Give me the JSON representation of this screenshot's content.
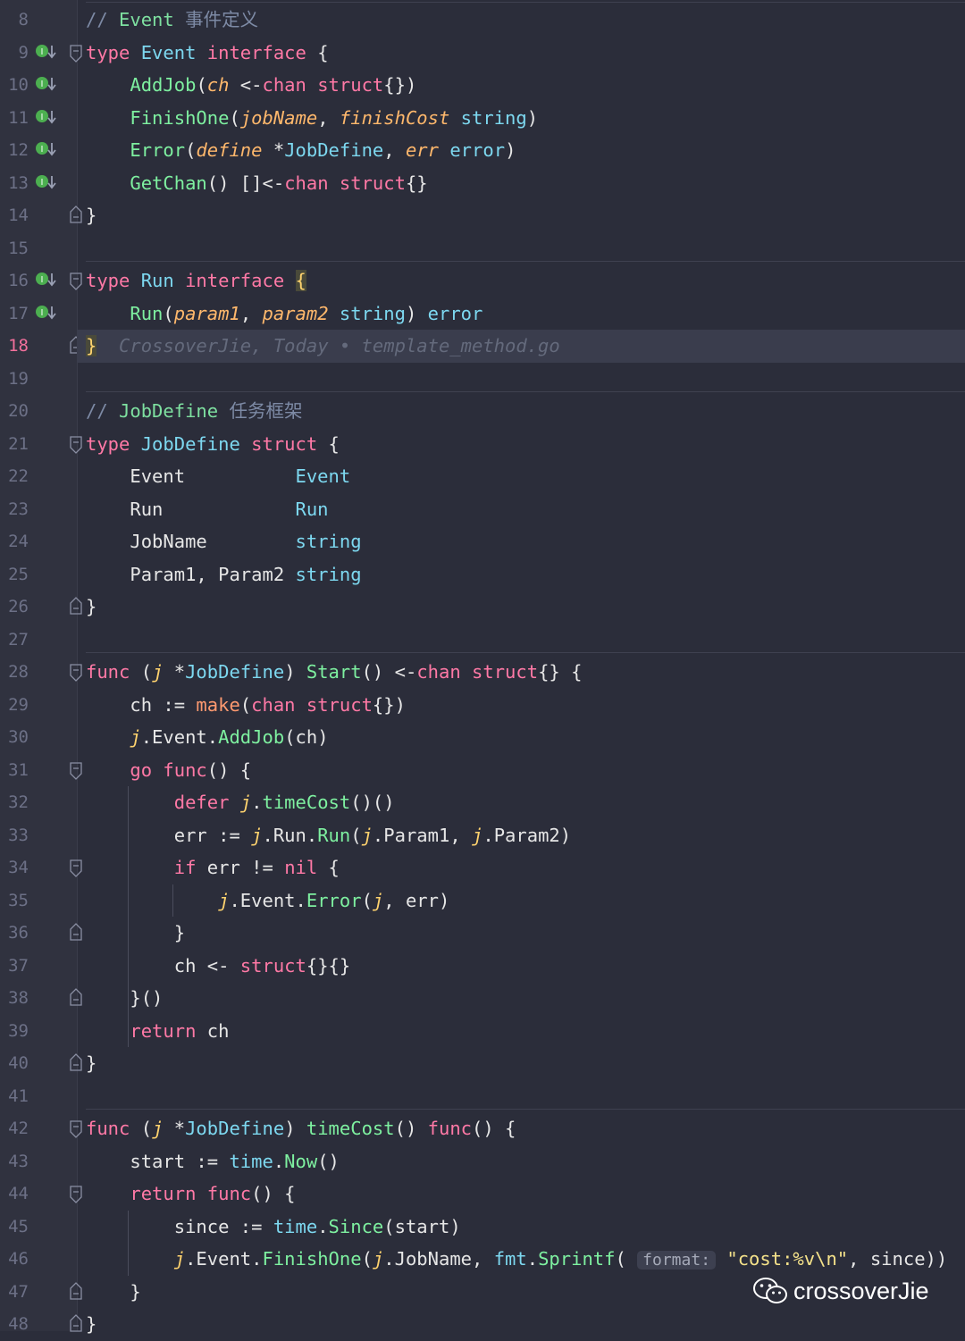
{
  "editor": {
    "file_blame": "CrossoverJie, Today • template_method.go",
    "current_line": 18,
    "watermark": "crossoverJie",
    "param_hint": "format:",
    "line_numbers": [
      "8",
      "9",
      "10",
      "11",
      "12",
      "13",
      "14",
      "15",
      "16",
      "17",
      "18",
      "19",
      "20",
      "21",
      "22",
      "23",
      "24",
      "25",
      "26",
      "27",
      "28",
      "29",
      "30",
      "31",
      "32",
      "33",
      "34",
      "35",
      "36",
      "37",
      "38",
      "39",
      "40",
      "41",
      "42",
      "43",
      "44",
      "45",
      "46",
      "47",
      "48"
    ],
    "tokens": {
      "event_comment_label": "Event",
      "event_comment_cjk": "事件定义",
      "jobdefine_comment_label": "JobDefine",
      "jobdefine_comment_cjk": "任务框架",
      "format_string": "\"cost:%v\\n\""
    }
  },
  "colors": {
    "background": "#2b2d3a",
    "keyword": "#ff79a6",
    "type": "#7dd8f0",
    "function": "#7ef0a0",
    "param": "#ffb86c",
    "string": "#f5e28a",
    "current_line_number": "#f2709c"
  },
  "icons": {
    "implementation_gutter": "implemented-interface-icon",
    "fold": "fold-marker-icon",
    "watermark": "wechat-icon"
  }
}
